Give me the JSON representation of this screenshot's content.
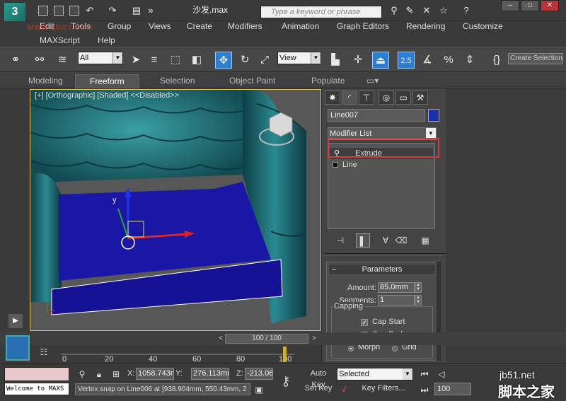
{
  "window": {
    "title": "沙发.max",
    "search_placeholder": "Type a keyword or phrase",
    "watermark": "WWW.3DXY.COM"
  },
  "menu": [
    "Edit",
    "Tools",
    "Group",
    "Views",
    "Create",
    "Modifiers",
    "Animation",
    "Graph Editors",
    "Rendering",
    "Customize",
    "MAXScript",
    "Help"
  ],
  "toolbar": {
    "selection_filter": "All",
    "reference_coord": "View",
    "snap_angle": "2.5",
    "create_selection": "Create Selection"
  },
  "ribbon_tabs": [
    "Modeling",
    "Freeform",
    "Selection",
    "Object Paint",
    "Populate"
  ],
  "viewport": {
    "label": "[+] [Orthographic] [Shaded]  <<Disabled>>",
    "axis_y": "y"
  },
  "command_panel": {
    "object_name": "Line007",
    "object_color": "#1c2fa8",
    "modifier_list": "Modifier List",
    "stack": [
      "Extrude",
      "Line"
    ],
    "parameters": {
      "title": "Parameters",
      "amount_label": "Amount:",
      "amount": "85.0mm",
      "segments_label": "Segments:",
      "segments": "1",
      "capping_label": "Capping",
      "cap_start": "Cap Start",
      "cap_end": "Cap End",
      "morph": "Morph",
      "grid": "Grid"
    }
  },
  "time": {
    "slider": "100 / 100",
    "ticks": [
      "0",
      "20",
      "40",
      "60",
      "80",
      "100"
    ],
    "frame": "100"
  },
  "status": {
    "maxscript_text": "Welcome to MAXS",
    "x_label": "X:",
    "x": "1058.743m",
    "y_label": "Y:",
    "y": "276.113mr",
    "z_label": "Z:",
    "z": "-213.06",
    "prompt": "Vertex snap on Line006 at [938.904mm, 550.43mm, 2",
    "auto_key": "Auto Key",
    "set_key": "Set Key",
    "key_mode": "Selected",
    "key_filters": "Key Filters..."
  },
  "site_watermark": {
    "line1": "jb51.net",
    "line2": "脚本之家"
  }
}
